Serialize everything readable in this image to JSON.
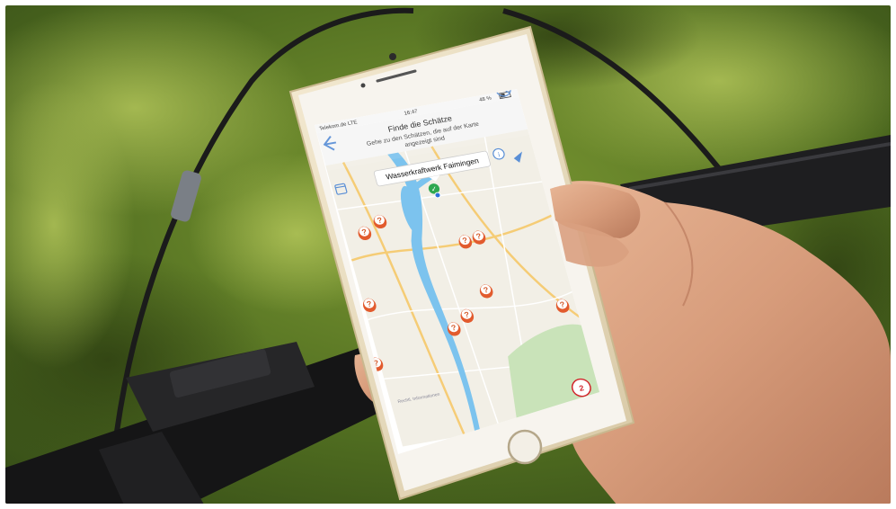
{
  "phone": {
    "status_bar": {
      "carrier": "Telekom.de LTE",
      "time": "16:47",
      "battery": "48 %"
    },
    "header": {
      "title": "Finde die Schätze",
      "subtitle_line1": "Gehe zu den Schätzen, die auf der Karte",
      "subtitle_line2": "angezeigt sind"
    },
    "map": {
      "callout_label": "Wasserkraftwerk Faimingen",
      "pin_glyph": "?",
      "found_glyph": "✓",
      "badge_count": "2",
      "attribution": "Rechtl. Informationen"
    },
    "icons": [
      "back-arrow-icon",
      "compass-icon",
      "calendar-icon",
      "info-icon",
      "location-arrow-icon"
    ]
  },
  "colors": {
    "pin": "#e25b2e",
    "found": "#2fa84f",
    "water": "#7cc3ee",
    "badge": "#d2232a"
  }
}
